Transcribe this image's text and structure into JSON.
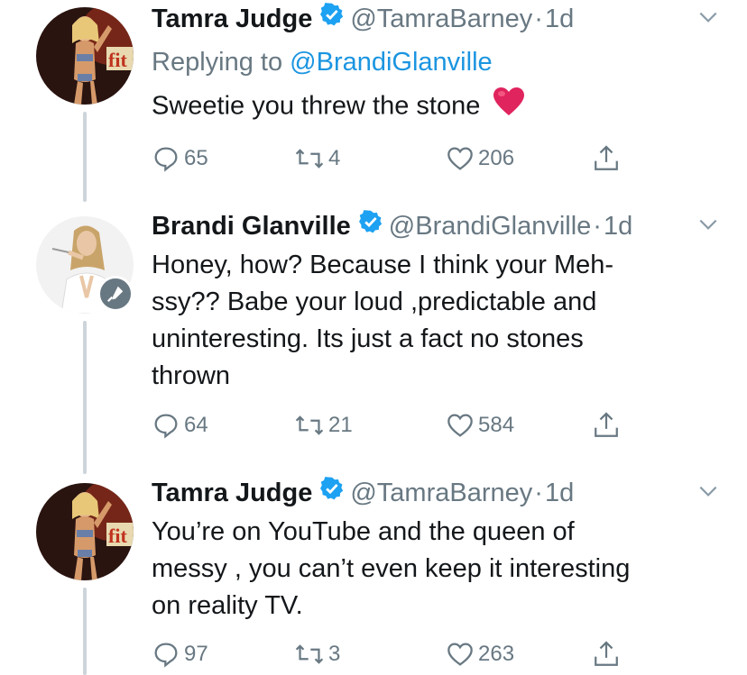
{
  "tweets": [
    {
      "name": "Tamra Judge",
      "handle": "@TamraBarney",
      "separator": "·",
      "time": "1d",
      "reply_prefix": "Replying to ",
      "reply_to": "@BrandiGlanville",
      "text": "Sweetie you threw the stone",
      "emoji": "red-heart",
      "replies": "65",
      "retweets": "4",
      "likes": "206"
    },
    {
      "name": "Brandi Glanville",
      "handle": "@BrandiGlanville",
      "separator": "·",
      "time": "1d",
      "text": "Honey, how? Because I think your  Meh-ssy??  Babe your loud ,predictable and uninteresting. Its just a fact no stones thrown",
      "text_lines": [
        "Honey, how? Because I think your  Meh-",
        "ssy??  Babe your loud ,predictable and",
        "uninteresting. Its just a fact no stones",
        "thrown"
      ],
      "replies": "64",
      "retweets": "21",
      "likes": "584"
    },
    {
      "name": "Tamra Judge",
      "handle": "@TamraBarney",
      "separator": "·",
      "time": "1d",
      "text": "You’re on YouTube and the queen of messy , you can’t even  keep it interesting on reality TV.",
      "text_lines": [
        "You’re on YouTube and the queen of",
        "messy , you can’t even  keep it interesting",
        "on reality TV."
      ],
      "replies": "97",
      "retweets": "3",
      "likes": "263"
    }
  ],
  "colors": {
    "text": "#14171a",
    "secondary": "#687882",
    "link": "#1b95e0",
    "verified": "#1da1f2",
    "thread_line": "#cdd4da",
    "heart_emoji": "#e0245e"
  },
  "icons": [
    "verified-badge-icon",
    "chevron-down-icon",
    "reply-icon",
    "retweet-icon",
    "like-icon",
    "share-icon",
    "microphone-icon",
    "red-heart-emoji"
  ]
}
